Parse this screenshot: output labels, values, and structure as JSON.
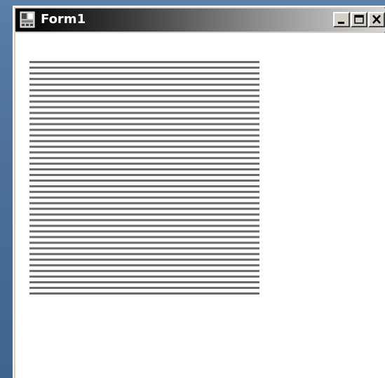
{
  "window": {
    "title": "Form1",
    "icon": "form-icon",
    "caption_buttons": [
      {
        "name": "minimize",
        "icon": "minimize-icon"
      },
      {
        "name": "maximize",
        "icon": "maximize-icon"
      },
      {
        "name": "close",
        "icon": "close-icon"
      }
    ]
  },
  "drawing": {
    "line_color": "#6a6a6a",
    "line_count": 42
  }
}
